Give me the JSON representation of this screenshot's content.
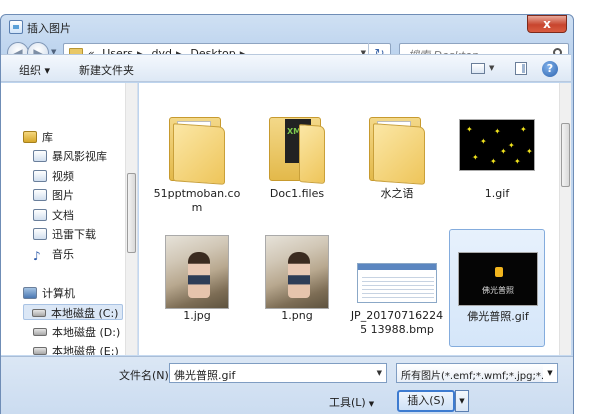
{
  "window": {
    "title": "插入图片",
    "close_label": "x"
  },
  "address": {
    "crumbs": [
      "«",
      "Users",
      "dyd",
      "Desktop"
    ],
    "search_placeholder": "搜索 Desktop"
  },
  "toolbar": {
    "organize": "组织 ▾",
    "new_folder": "新建文件夹",
    "help": "?"
  },
  "nav": {
    "items": [
      {
        "label": "库",
        "icon": "library-icon"
      },
      {
        "label": "暴风影视库",
        "icon": "video-library-icon"
      },
      {
        "label": "视频",
        "icon": "videos-icon"
      },
      {
        "label": "图片",
        "icon": "pictures-icon"
      },
      {
        "label": "文档",
        "icon": "documents-icon"
      },
      {
        "label": "迅雷下载",
        "icon": "thunder-download-icon"
      },
      {
        "label": "音乐",
        "icon": "music-icon"
      },
      {
        "label": "计算机",
        "icon": "computer-icon"
      },
      {
        "label": "本地磁盘 (C:)",
        "icon": "drive-icon"
      },
      {
        "label": "本地磁盘 (D:)",
        "icon": "drive-icon"
      },
      {
        "label": "本地磁盘 (E:)",
        "icon": "drive-icon"
      }
    ]
  },
  "files": [
    {
      "name": "51pptmoban.com",
      "type": "folder"
    },
    {
      "name": "Doc1.files",
      "type": "folder"
    },
    {
      "name": "水之语",
      "type": "folder"
    },
    {
      "name": "1.gif",
      "type": "gif"
    },
    {
      "name": "1.jpg",
      "type": "jpg"
    },
    {
      "name": "1.png",
      "type": "png"
    },
    {
      "name": "JP_201707162245 13988.bmp",
      "type": "bmp"
    },
    {
      "name": "佛光普照.gif",
      "type": "gif",
      "selected": true,
      "caption": "佛光普照"
    }
  ],
  "footer": {
    "filename_label": "文件名(N):",
    "filename_value": "佛光普照.gif",
    "filter_value": "所有图片(*.emf;*.wmf;*.jpg;*.jp",
    "tools_label": "工具(L)",
    "insert_label": "插入(S)"
  }
}
